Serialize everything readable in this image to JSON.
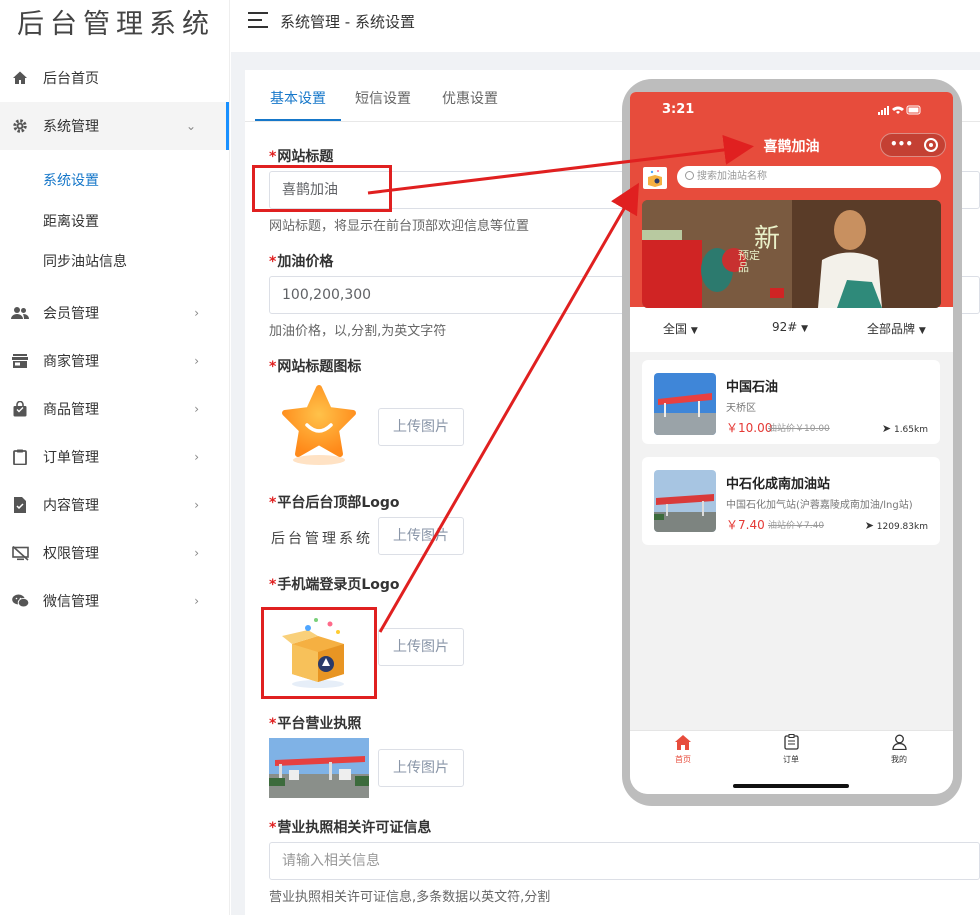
{
  "app": {
    "logo_text": "后台管理系统"
  },
  "sidebar": {
    "items": [
      {
        "label": "后台首页",
        "icon": "home-icon"
      },
      {
        "label": "系统管理",
        "icon": "gear-icon"
      },
      {
        "label": "会员管理",
        "icon": "users-icon"
      },
      {
        "label": "商家管理",
        "icon": "store-icon"
      },
      {
        "label": "商品管理",
        "icon": "bag-icon"
      },
      {
        "label": "订单管理",
        "icon": "clipboard-icon"
      },
      {
        "label": "内容管理",
        "icon": "document-icon"
      },
      {
        "label": "权限管理",
        "icon": "desktop-off-icon"
      },
      {
        "label": "微信管理",
        "icon": "wechat-icon"
      }
    ],
    "sub_items": [
      {
        "label": "系统设置",
        "active": true
      },
      {
        "label": "距离设置"
      },
      {
        "label": "同步油站信息"
      }
    ]
  },
  "header": {
    "breadcrumb": "系统管理 - 系统设置"
  },
  "tabs": [
    {
      "label": "基本设置",
      "active": true
    },
    {
      "label": "短信设置"
    },
    {
      "label": "优惠设置"
    }
  ],
  "form": {
    "site_title": {
      "label": "网站标题",
      "value": "喜鹊加油",
      "help": "网站标题，将显示在前台顶部欢迎信息等位置"
    },
    "fuel_price": {
      "label": "加油价格",
      "value": "100,200,300",
      "help": "加油价格，以,分割,为英文字符"
    },
    "site_icon": {
      "label": "网站标题图标",
      "upload": "上传图片"
    },
    "admin_logo": {
      "label": "平台后台顶部Logo",
      "upload": "上传图片",
      "logo_text": "后台管理系统"
    },
    "mobile_login_logo": {
      "label": "手机端登录页Logo",
      "upload": "上传图片"
    },
    "business_license": {
      "label": "平台营业执照",
      "upload": "上传图片"
    },
    "license_info": {
      "label": "营业执照相关许可证信息",
      "placeholder": "请输入相关信息",
      "help": "营业执照相关许可证信息,多条数据以英文符,分割"
    }
  },
  "phone": {
    "time": "3:21",
    "title": "喜鹊加油",
    "search_placeholder": "搜索加油站名称",
    "banner_text": "新",
    "banner_sub": "预定品",
    "filters": [
      "全国",
      "92#",
      "全部品牌"
    ],
    "stations": [
      {
        "name": "中国石油",
        "address": "天桥区",
        "price": "￥10.00",
        "old_price": "油站价￥10.00",
        "distance": "1.65km"
      },
      {
        "name": "中石化成南加油站",
        "address": "中国石化加气站(沪蓉嘉陵成南加油/lng站)",
        "price": "￥7.40",
        "old_price": "油站价￥7.40",
        "distance": "1209.83km"
      }
    ],
    "tabbar": [
      "首页",
      "订单",
      "我的"
    ]
  },
  "colors": {
    "accent": "#1677c9",
    "brand_red": "#e74c3c",
    "annotation_red": "#e02020"
  }
}
